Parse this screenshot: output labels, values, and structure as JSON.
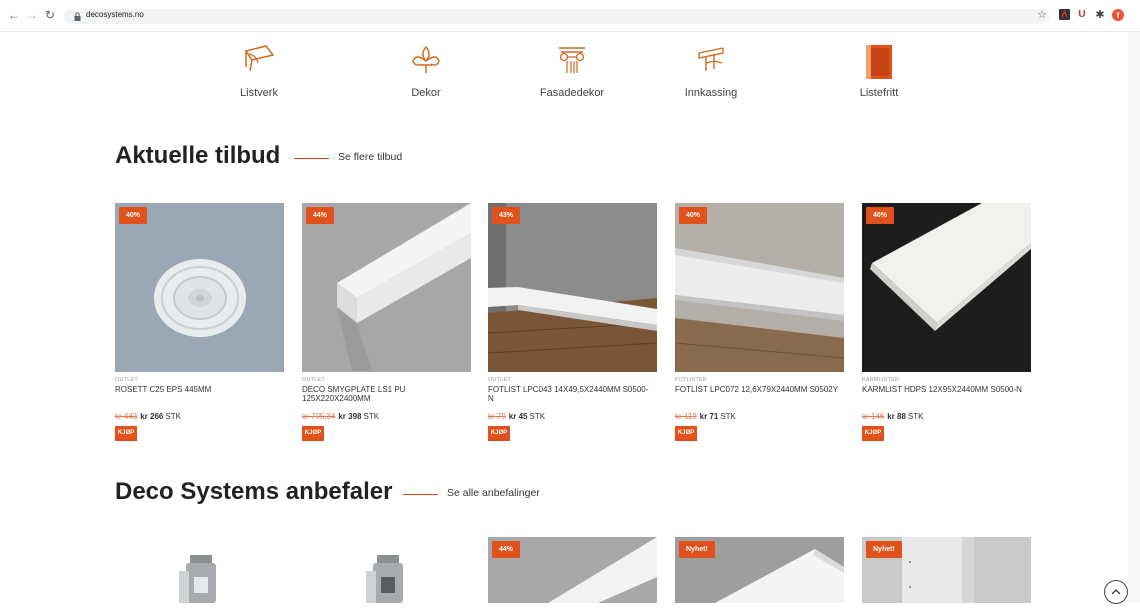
{
  "browser": {
    "url": "decosystems.no"
  },
  "categories": [
    {
      "label": "Listverk",
      "icon": "crown-molding-icon"
    },
    {
      "label": "Dekor",
      "icon": "fleur-de-lis-icon"
    },
    {
      "label": "Fasadedekor",
      "icon": "column-capital-icon"
    },
    {
      "label": "Innkassing",
      "icon": "boxing-icon"
    },
    {
      "label": "Listefritt",
      "icon": "door-panel-icon"
    }
  ],
  "offers": {
    "title": "Aktuelle tilbud",
    "link": "Se flere tilbud",
    "products": [
      {
        "badge": "40%",
        "category": "OUTLET",
        "name": "ROSETT C25 EPS 445MM",
        "old_price": "kr 443",
        "new_price": "kr 266",
        "unit": "STK",
        "buy": "KJØP"
      },
      {
        "badge": "44%",
        "category": "OUTLET",
        "name": "DECO SMYGPLATE LS1 PU 125X220X2400MM",
        "old_price": "kr 705,34",
        "new_price": "kr 398",
        "unit": "STK",
        "buy": "KJØP"
      },
      {
        "badge": "43%",
        "category": "OUTLET",
        "name": "FOTLIST LPC043 14X49,5X2440MM S0500-N",
        "old_price": "kr 79",
        "new_price": "kr 45",
        "unit": "STK",
        "buy": "KJØP"
      },
      {
        "badge": "40%",
        "category": "FOTLISTER",
        "name": "FOTLIST LPC072 12,6X79X2440MM S0502Y",
        "old_price": "kr 119",
        "new_price": "kr 71",
        "unit": "STK",
        "buy": "KJØP"
      },
      {
        "badge": "40%",
        "category": "KARMLISTER",
        "name": "KARMLIST HDPS 12X95X2440MM S0500-N",
        "old_price": "kr 146",
        "new_price": "kr 88",
        "unit": "STK",
        "buy": "KJØP"
      }
    ]
  },
  "recommend": {
    "title": "Deco Systems anbefaler",
    "link": "Se alle anbefalinger",
    "badges": [
      "",
      "",
      "44%",
      "Nyhet!",
      "Nyhet!"
    ]
  },
  "colors": {
    "accent": "#e0511b",
    "icon": "#d2691e"
  }
}
